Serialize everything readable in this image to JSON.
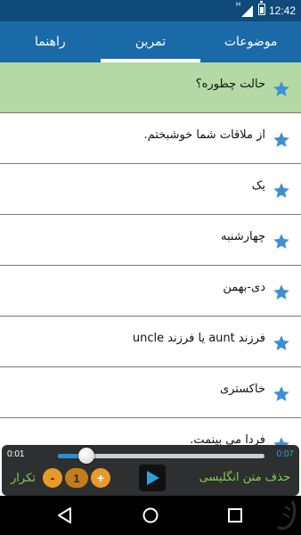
{
  "status_bar": {
    "time": "12:42",
    "network_letter": "H",
    "icons": [
      "signal-icon",
      "battery-icon"
    ]
  },
  "tabs": [
    {
      "label": "راهنما",
      "active": false
    },
    {
      "label": "تمرین",
      "active": true
    },
    {
      "label": "موضوعات",
      "active": false
    }
  ],
  "list": {
    "items": [
      {
        "text": "حالت چطوره؟",
        "selected": true
      },
      {
        "text": "از ملاقات شما خوشبختم.",
        "selected": false
      },
      {
        "text": "یک",
        "selected": false
      },
      {
        "text": "چهارشنبه",
        "selected": false
      },
      {
        "text": "دی-بهمن",
        "selected": false
      },
      {
        "text": "فرزند aunt یا فرزند uncle",
        "selected": false
      },
      {
        "text": "خاکستری",
        "selected": false
      },
      {
        "text": "فردا می بینمت.",
        "selected": false
      }
    ]
  },
  "player": {
    "current_time": "0:01",
    "total_time": "0:07",
    "progress": 0.14,
    "repeat_label": "تکرار",
    "repeat_count": "1",
    "minus_label": "-",
    "plus_label": "+",
    "remove_english_label": "حذف متن انگلیسی"
  },
  "colors": {
    "status_bar": "#0f4a7a",
    "tab_bar": "#1b6aa8",
    "selected_row": "#b4d9a4",
    "star": "#3d8fd6",
    "player_bg": "#2d2f30",
    "accent_green": "#7fd14a",
    "accent_orange": "#e89a2a",
    "time_blue": "#29a3dd"
  }
}
